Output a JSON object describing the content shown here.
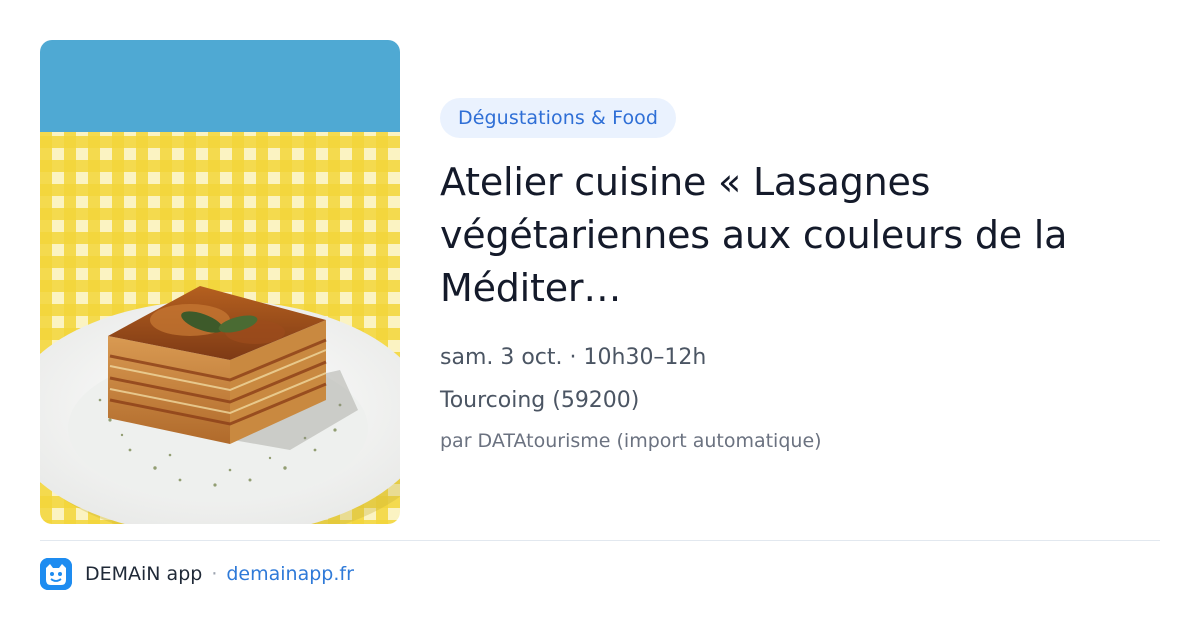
{
  "event": {
    "category": "Dégustations & Food",
    "title": "Atelier cuisine « Lasagnes végétariennes aux couleurs de la Méditer…",
    "datetime": "sam. 3 oct. · 10h30–12h",
    "location": "Tourcoing (59200)",
    "source": "par DATAtourisme (import automatique)",
    "image": {
      "subject": "lasagna-on-plate",
      "colors": {
        "sky": "#4fa9d3",
        "tablecloth": "#f4d63a",
        "plate": "#f4f4f2"
      }
    }
  },
  "footer": {
    "app_name": "DEMAiN app",
    "separator": "·",
    "domain": "demainapp.fr",
    "logo_icon": "demain-app-logo-icon"
  },
  "theme": {
    "accent": "#2f6fd6",
    "badge_bg": "#eaf2fe",
    "logo_bg": "#1e8cf0"
  }
}
